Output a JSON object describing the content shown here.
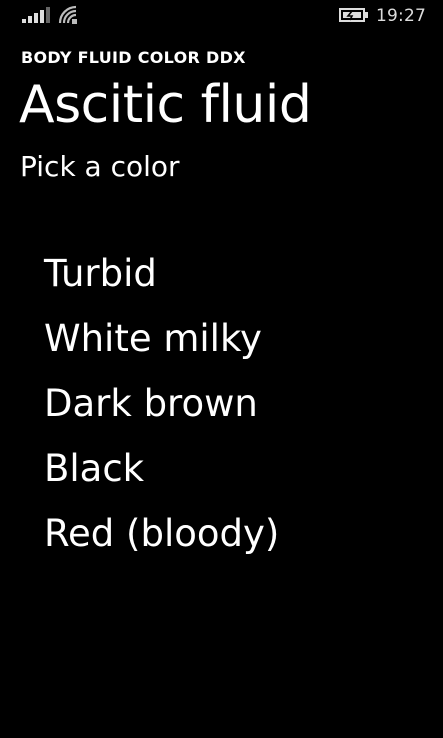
{
  "status_bar": {
    "time": "19:27",
    "signal_icon": "signal-strength-icon",
    "wifi_icon": "wifi-icon",
    "battery_icon": "battery-charging-icon"
  },
  "header": {
    "app_title": "BODY FLUID COLOR DDX",
    "page_title": "Ascitic fluid",
    "subtitle": "Pick a color"
  },
  "colors": {
    "items": [
      {
        "label": "Turbid"
      },
      {
        "label": "White milky"
      },
      {
        "label": "Dark brown"
      },
      {
        "label": "Black"
      },
      {
        "label": "Red (bloody)"
      }
    ]
  },
  "theme": {
    "background": "#000000",
    "foreground": "#ffffff"
  }
}
